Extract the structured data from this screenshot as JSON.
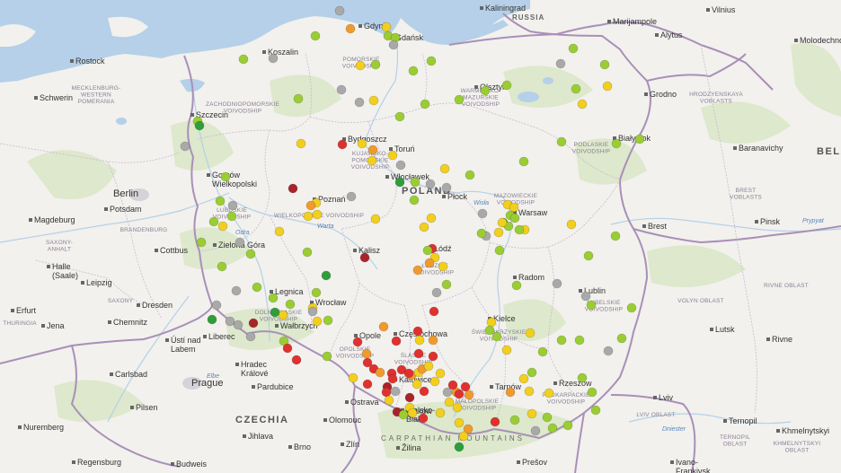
{
  "colors": {
    "sea": "#b5d0e8",
    "land": "#f2f1ed",
    "forest": "#d8e6c4",
    "border": "#a98fb8",
    "water": "#b5d0e8",
    "very_good": "#2e9e3a",
    "good": "#9acd32",
    "moderate": "#f2cf1d",
    "sufficient": "#f19a2c",
    "bad": "#e0312f",
    "very_bad": "#a8242a",
    "no_data": "#a9a9a9"
  },
  "labels": {
    "countries": {
      "russia": "RUSSIA",
      "poland": "POLAND",
      "czechia": "CZECHIA",
      "belarus": "BELA"
    },
    "mountains": "CARPATHIAN MOUNTAINS",
    "cities": {
      "kaliningrad": "Kaliningrad",
      "marijampole": "Marijampole",
      "vilnius": "Vilnius",
      "alytus": "Alytus",
      "molodechno": "Molodechno",
      "grodno": "Grodno",
      "baranavichy": "Baranavichy",
      "pinsk": "Pinsk",
      "brest": "Brest",
      "lutsk": "Lutsk",
      "rivne": "Rivne",
      "lviv": "Lviv",
      "ternopil": "Ternopil",
      "khmelnytskyi": "Khmelnytskyi",
      "ivano_frankivsk": "Ivano-\nFrankivsk",
      "rostock": "Rostock",
      "schwerin": "Schwerin",
      "szczecin": "Szczecin",
      "berlin": "Berlin",
      "potsdam": "Potsdam",
      "magdeburg": "Magdeburg",
      "cottbus": "Cottbus",
      "halle": "Halle\n(Saale)",
      "leipzig": "Leipzig",
      "dresden": "Dresden",
      "chemnitz": "Chemnitz",
      "erfurt": "Erfurt",
      "jena": "Jena",
      "usti": "Ústí nad\nLabem",
      "liberec": "Liberec",
      "prague": "Prague",
      "pardubice": "Pardubice",
      "hradec": "Hradec\nKrálové",
      "carlsbad": "Carlsbad",
      "plzen": "Pilsen",
      "nuremberg": "Nuremberg",
      "regensburg": "Regensburg",
      "budweis": "Budweis",
      "jihlava": "Jihlava",
      "brno": "Brno",
      "olomouc": "Olomouc",
      "zlin": "Zlín",
      "ostrava": "Ostrava",
      "zilina": "Žilina",
      "presov": "Prešov",
      "koszalin": "Koszalin",
      "gdynia": "Gdynia",
      "gdansk": "Gdańsk",
      "olsztyn": "Olsztyn",
      "bialystok": "Białystok",
      "bydgoszcz": "Bydgoszcz",
      "torun": "Toruń",
      "wloclawek": "Włocławek",
      "plock": "Płock",
      "gorzow": "Gorzów\nWielkopolski",
      "poznan": "Poznań",
      "warsaw": "Warsaw",
      "zielona_gora": "Zielona Góra",
      "kalisz": "Kalisz",
      "lodz": "Łódź",
      "radom": "Radom",
      "lublin": "Lublin",
      "legnica": "Legnica",
      "wroclaw": "Wrocław",
      "walbrzych": "Wałbrzych",
      "opole": "Opole",
      "czestochowa": "Częstochowa",
      "kielce": "Kielce",
      "katowice": "Katowice",
      "krakow": "Kraków",
      "tarnow": "Tarnów",
      "rzeszow": "Rzeszów",
      "bielsko": "Bielsko-\nBiała"
    },
    "regions": {
      "mecklenburg": "MECKLENBURG-\nWESTERN\nPOMERANIA",
      "brandenburg": "BRANDENBURG",
      "saxony_anhalt": "SAXONY-\nANHALT",
      "saxony": "SAXONY",
      "thuringia": "THURINGIA",
      "zachodniopomorskie": "ZACHODNIOPOMORSKIE\nVOIVODSHIP",
      "pomorskie": "POMORSKIE\nVOIVODSHIP",
      "warminsko": "WARMIŃSKO-\nMAZURSKIE\nVOIVODSHIP",
      "podlaskie": "PODLASKIE\nVOIVODSHIP",
      "kujawsko": "KUJAWSKO-\nPOMORSKIE\nVOIVODSHIP",
      "lubuskie": "LUBUSKIE\nVOIVODSHIP",
      "wielkopolskie": "WIELKOPOLSKIE VOIVODSHIP",
      "mazowieckie": "MAZOWIECKIE\nVOIVODSHIP",
      "lodzkie": "ŁÓDZKIE\nVOIVODSHIP",
      "lubelskie": "LUBELSKIE\nVOIVODSHIP",
      "dolnoslaskie": "DOLNOŚLĄSKIE\nVOIVODSHIP",
      "opolskie": "OPOLSKIE\nVOIVODSHIP",
      "slaskie": "ŚLĄSKIE\nVOIVODSHIP",
      "swietokrzyskie": "ŚWIĘTOKRZYSKIE\nVOIVODSHIP",
      "malopolskie": "MAŁOPOLSKIE\nVOIVODSHIP",
      "podkarpackie": "PODKARPACKIE\nVOIVODSHIP",
      "hrodzyenskaya": "HRODZYENSKAYA\nVOBLASTS",
      "brest_vob": "BREST\nVOBLASTS",
      "volyn": "VOLYN OBLAST",
      "rivne_obl": "RIVNE OBLAST",
      "lviv_obl": "LVIV OBLAST",
      "ternopil_obl": "TERNOPIL\nOBLAST",
      "khmelnytskyi_obl": "KHMELNYTSKYI\nOBLAST"
    },
    "rivers": {
      "vistula": "Wisła",
      "odra": "Odra",
      "warta": "Warta",
      "elbe": "Elbe",
      "pripyat": "Prypyat",
      "dniester": "Dniester"
    }
  },
  "stations": [
    {
      "q": "no_data",
      "lat": 54.35
    },
    {
      "q": "sufficient",
      "lat": 54.55
    },
    {
      "q": "moderate",
      "lat": 54.52
    },
    {
      "q": "good",
      "lat": 54.47
    }
  ]
}
